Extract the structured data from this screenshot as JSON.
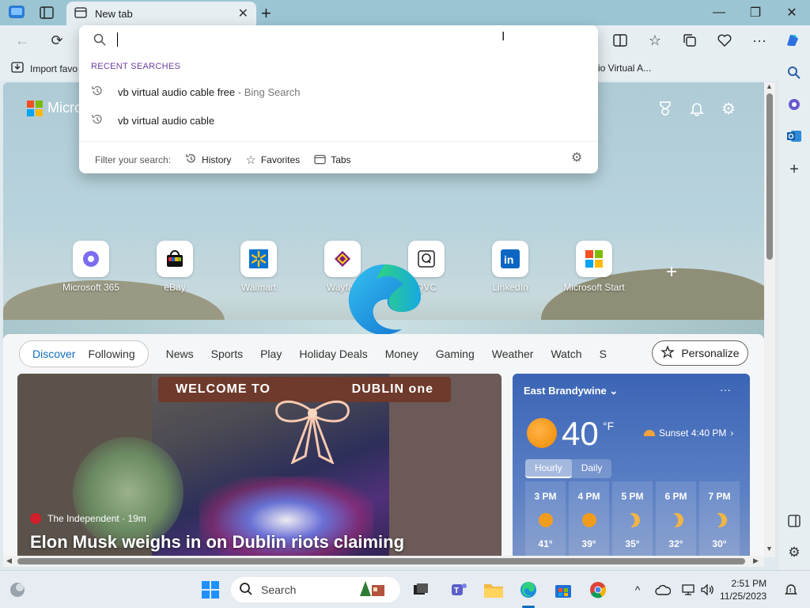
{
  "browser": {
    "tab_title": "New tab",
    "favorites_bar": {
      "import_label": "Import favo",
      "right_item": "io Virtual A..."
    }
  },
  "newtab": {
    "logo_text": "Micro",
    "quick_links": [
      {
        "label": "Microsoft 365",
        "icon": "m365-icon"
      },
      {
        "label": "eBay",
        "icon": "ebay-icon"
      },
      {
        "label": "Walmart",
        "icon": "walmart-icon"
      },
      {
        "label": "Wayfair",
        "icon": "wayfair-icon"
      },
      {
        "label": "QVC",
        "icon": "qvc-icon"
      },
      {
        "label": "LinkedIn",
        "icon": "linkedin-icon"
      },
      {
        "label": "Microsoft Start",
        "icon": "microsoft-start-icon"
      }
    ],
    "add_link": "+"
  },
  "feed": {
    "pill_tabs": [
      "Discover",
      "Following"
    ],
    "nav": [
      "News",
      "Sports",
      "Play",
      "Holiday Deals",
      "Money",
      "Gaming",
      "Weather",
      "Watch",
      "S"
    ],
    "personalize": "Personalize",
    "hero": {
      "banner_left": "WELCOME TO",
      "banner_right": "DUBLIN one",
      "source": "The Independent · 19m",
      "headline": "Elon Musk weighs in on Dublin riots claiming"
    },
    "weather": {
      "location": "East Brandywine",
      "more": "···",
      "temp": "40",
      "unit": "°F",
      "sunset": "Sunset 4:40 PM",
      "toggle": [
        "Hourly",
        "Daily"
      ],
      "hours": [
        {
          "time": "3 PM",
          "icon": "sun",
          "temp": "41°"
        },
        {
          "time": "4 PM",
          "icon": "sun",
          "temp": "39°"
        },
        {
          "time": "5 PM",
          "icon": "moon",
          "temp": "35°"
        },
        {
          "time": "6 PM",
          "icon": "moon",
          "temp": "32°"
        },
        {
          "time": "7 PM",
          "icon": "moon",
          "temp": "30°"
        }
      ]
    }
  },
  "dropdown": {
    "section": "RECENT SEARCHES",
    "items": [
      {
        "text": "vb virtual audio cable free",
        "sub": " - Bing Search"
      },
      {
        "text": "vb virtual audio cable",
        "sub": ""
      }
    ],
    "filter_label": "Filter your search:",
    "filters": [
      "History",
      "Favorites",
      "Tabs"
    ]
  },
  "taskbar": {
    "search_label": "Search",
    "time": "2:51 PM",
    "date": "11/25/2023"
  },
  "colors": {
    "accent": "#0f6cbd",
    "section": "#6b3fa0"
  }
}
